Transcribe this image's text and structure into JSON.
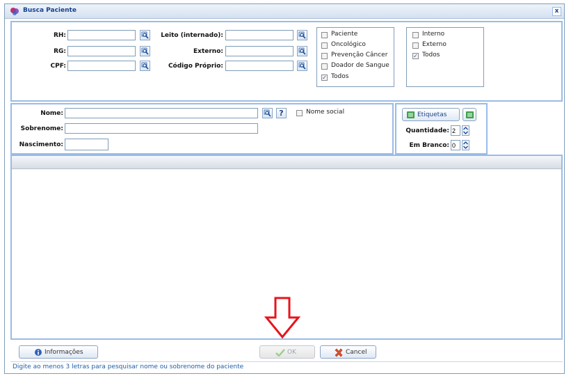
{
  "window": {
    "title": "Busca Paciente",
    "close_glyph": "x"
  },
  "fields": {
    "rh": {
      "label": "RH:",
      "value": ""
    },
    "rg": {
      "label": "RG:",
      "value": ""
    },
    "cpf": {
      "label": "CPF:",
      "value": ""
    },
    "leito": {
      "label": "Leito (internado):",
      "value": ""
    },
    "externo": {
      "label": "Externo:",
      "value": ""
    },
    "codigo": {
      "label": "Código Próprio:",
      "value": ""
    }
  },
  "filter_type": {
    "options": [
      {
        "label": "Paciente",
        "checked": false
      },
      {
        "label": "Oncológico",
        "checked": false
      },
      {
        "label": "Prevenção Câncer",
        "checked": false
      },
      {
        "label": "Doador de Sangue",
        "checked": false
      },
      {
        "label": "Todos",
        "checked": true
      }
    ]
  },
  "filter_location": {
    "options": [
      {
        "label": "Interno",
        "checked": false
      },
      {
        "label": "Externo",
        "checked": false
      },
      {
        "label": "Todos",
        "checked": true
      }
    ]
  },
  "name_fields": {
    "nome": {
      "label": "Nome:",
      "value": ""
    },
    "sobrenome": {
      "label": "Sobrenome:",
      "value": ""
    },
    "nascimento": {
      "label": "Nascimento:",
      "value": ""
    },
    "help_glyph": "?",
    "nome_social": {
      "label": "Nome social",
      "checked": false
    }
  },
  "labels_panel": {
    "etiquetas_label": "Etiquetas",
    "quantidade": {
      "label": "Quantidade:",
      "value": "2"
    },
    "em_branco": {
      "label": "Em Branco:",
      "value": "0"
    }
  },
  "footer": {
    "info_label": "Informações",
    "ok_label": "OK",
    "cancel_label": "Cancel",
    "status_text": "Digite ao menos 3 letras para pesquisar nome ou sobrenome do paciente"
  },
  "colors": {
    "accent": "#99bbe8",
    "title": "#15428b",
    "arrow": "#e8141c",
    "status": "#1f5fa8"
  },
  "icons": {
    "app": "app-logo-icon",
    "search": "search-icon",
    "help": "help-icon",
    "list": "list-icon",
    "info": "info-icon",
    "ok": "check-icon",
    "cancel": "cancel-icon",
    "annotation": "down-arrow-icon"
  }
}
